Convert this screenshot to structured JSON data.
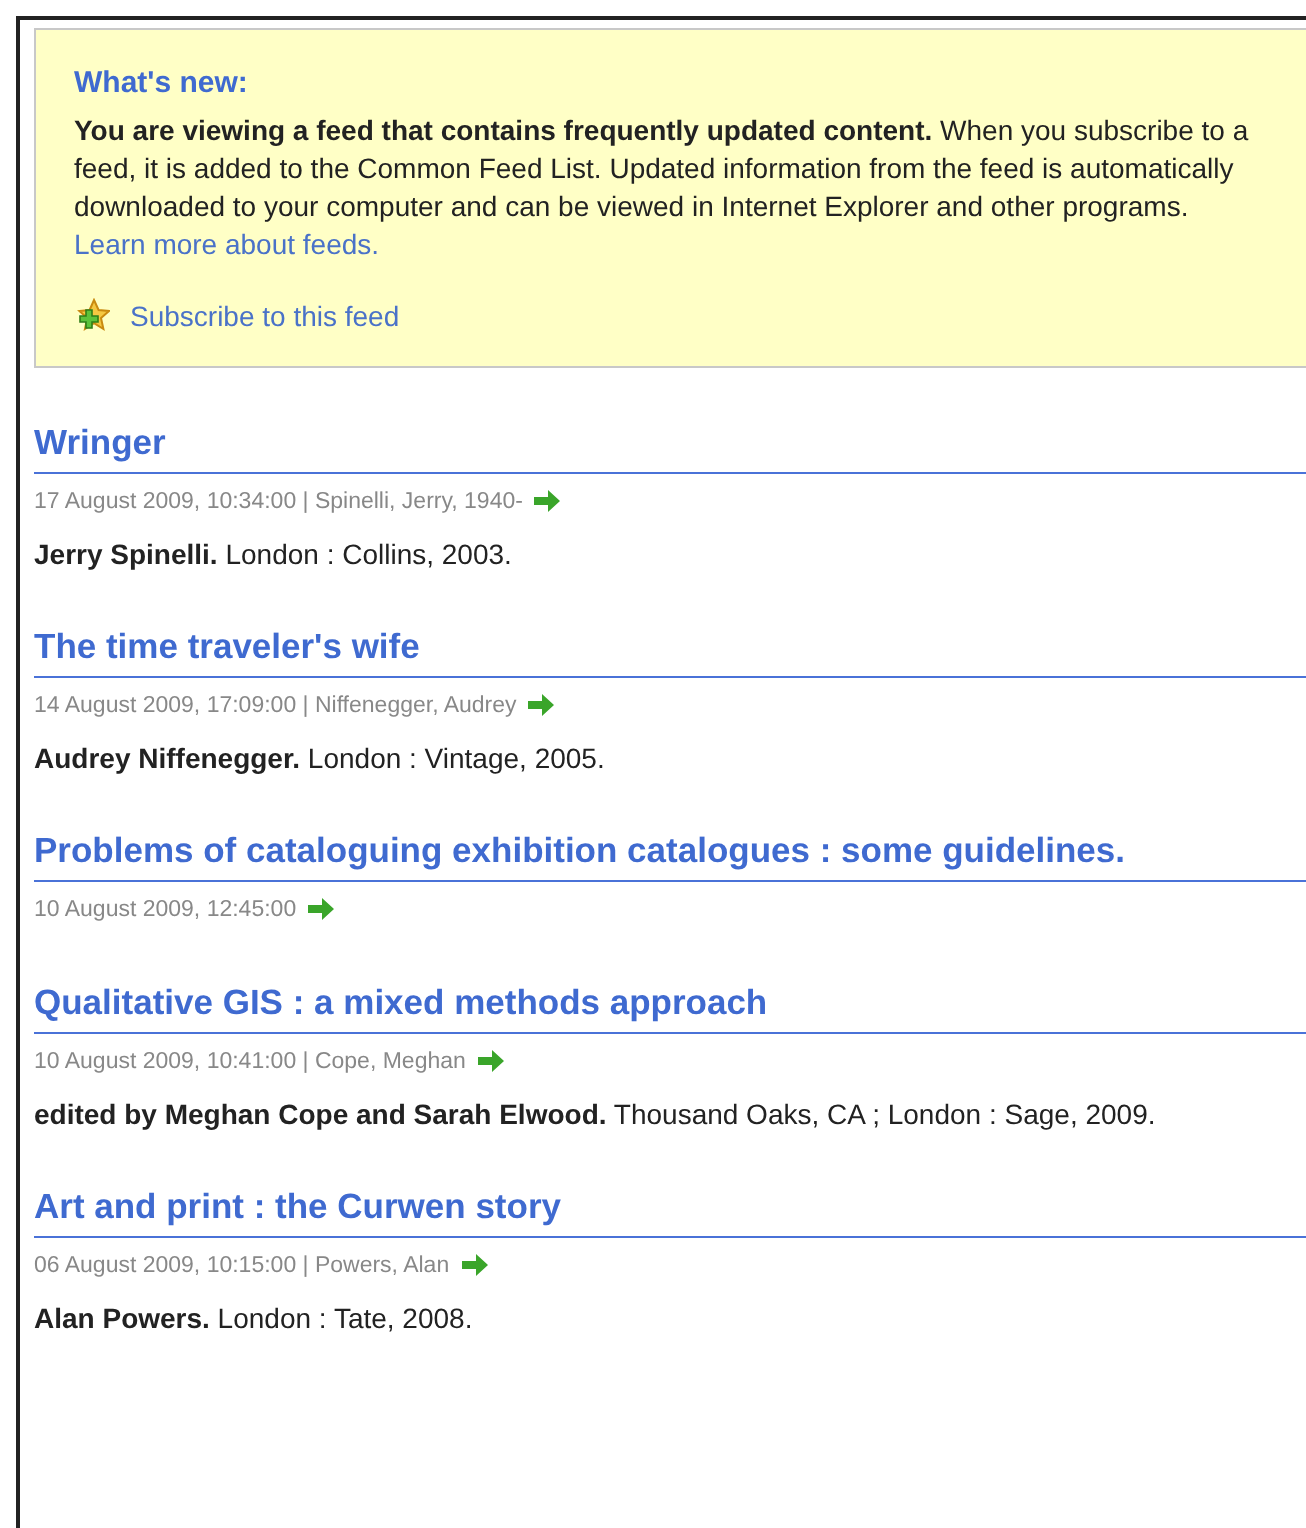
{
  "whats_new": {
    "heading": "What's new:",
    "text": "**You are viewing a feed that contains frequently updated content.** When you subscribe to a feed, it is added to the Common Feed List. Updated information from the feed is automatically downloaded to your computer and can be viewed in Internet Explorer and other programs.",
    "link": "Learn more about feeds.",
    "subscribe": "Subscribe to this feed"
  },
  "entries": [
    {
      "title": "Wringer",
      "meta": "17 August 2009, 10:34:00 | Spinelli, Jerry, 1940-",
      "description": "**Jerry Spinelli.** London : Collins, 2003."
    },
    {
      "title": "The time traveler's wife",
      "meta": "14 August 2009, 17:09:00 | Niffenegger, Audrey",
      "description": "**Audrey Niffenegger.** London : Vintage, 2005."
    },
    {
      "title": "Problems of cataloguing exhibition catalogues : some guidelines.",
      "meta": "10 August 2009, 12:45:00"
    },
    {
      "title": "Qualitative GIS : a mixed methods approach",
      "meta": "10 August 2009, 10:41:00 | Cope, Meghan",
      "description": "**edited by Meghan Cope and Sarah Elwood.** Thousand Oaks, CA ; London : Sage, 2009."
    },
    {
      "title": "Art and print : the Curwen story",
      "meta": "06 August 2009, 10:15:00 | Powers, Alan",
      "description": "**Alan Powers.** London : Tate, 2008."
    }
  ]
}
